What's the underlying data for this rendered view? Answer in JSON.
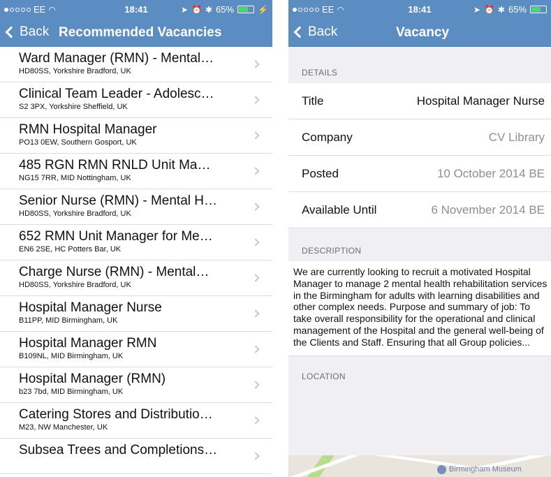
{
  "status": {
    "carrier": "EE",
    "time": "18:41",
    "battery": "65%",
    "battery_level": 0.65
  },
  "left": {
    "nav": {
      "back_label": "Back",
      "title": "Recommended Vacancies"
    },
    "items": [
      {
        "title": "Ward Manager (RMN) - Mental…",
        "location": "HD80SS, Yorkshire Bradford, UK"
      },
      {
        "title": "Clinical Team Leader - Adolesc…",
        "location": "S2 3PX, Yorkshire Sheffield, UK"
      },
      {
        "title": "RMN Hospital Manager",
        "location": "PO13 0EW, Southern Gosport, UK"
      },
      {
        "title": "485 RGN RMN RNLD Unit Ma…",
        "location": "NG15 7RR, MID Nottingham, UK"
      },
      {
        "title": "Senior Nurse (RMN) - Mental H…",
        "location": "HD80SS, Yorkshire Bradford, UK"
      },
      {
        "title": "652 RMN Unit Manager for Me…",
        "location": "EN6 2SE, HC Potters Bar, UK"
      },
      {
        "title": "Charge Nurse (RMN) - Mental…",
        "location": "HD80SS, Yorkshire Bradford, UK"
      },
      {
        "title": "Hospital Manager Nurse",
        "location": "B11PP, MID Birmingham, UK"
      },
      {
        "title": "Hospital Manager RMN",
        "location": "B109NL, MID Birmingham, UK"
      },
      {
        "title": "Hospital Manager (RMN)",
        "location": "b23 7bd, MID Birmingham, UK"
      },
      {
        "title": "Catering Stores and Distributio…",
        "location": "M23, NW Manchester, UK"
      },
      {
        "title": "Subsea Trees and Completions…",
        "location": ""
      }
    ]
  },
  "right": {
    "nav": {
      "back_label": "Back",
      "title": "Vacancy"
    },
    "details_header": "DETAILS",
    "details": [
      {
        "key": "Title",
        "value": "Hospital Manager Nurse"
      },
      {
        "key": "Company",
        "value": "CV Library"
      },
      {
        "key": "Posted",
        "value": "10 October 2014 BE"
      },
      {
        "key": "Available Until",
        "value": "6 November 2014 BE"
      }
    ],
    "description_header": "DESCRIPTION",
    "description": "We are currently looking to recruit a motivated Hospital Manager to manage 2 mental health rehabilitation services in the Birmingham for adults with learning disabilities and other complex needs. Purpose and summary of job: To take overall responsibility for the operational and clinical management of the Hospital and the general well-being of the Clients and Staff. Ensuring that all Group policies...",
    "location_header": "LOCATION",
    "map_label": "Birmingham Museum"
  },
  "colors": {
    "nav_bg": "#5b8cc2",
    "separator": "#dcdce0",
    "grouped_bg": "#efeff4",
    "chevron": "#c7c7cc"
  }
}
